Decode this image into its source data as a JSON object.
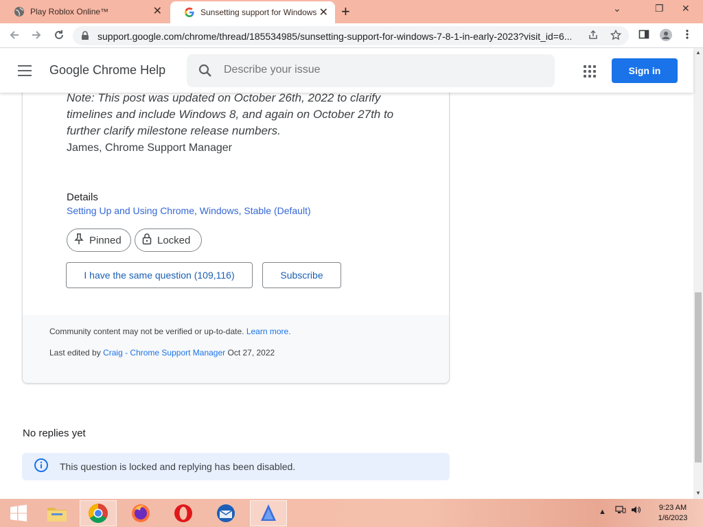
{
  "tabs": [
    {
      "title": "Play Roblox Online™",
      "close": "✕"
    },
    {
      "title": "Sunsetting support for Windows",
      "close": "✕"
    }
  ],
  "new_tab_label": "+",
  "window_controls": {
    "minimize": "⌄",
    "restore": "❐",
    "close": "✕"
  },
  "address_bar": {
    "url": "support.google.com/chrome/thread/185534985/sunsetting-support-for-windows-7-8-1-in-early-2023?visit_id=6..."
  },
  "header": {
    "site_title": "Google Chrome Help",
    "search_placeholder": "Describe your issue",
    "signin_label": "Sign in"
  },
  "post": {
    "note": "Note: This post was updated on October 26th, 2022 to clarify timelines and include Windows 8, and again on October 27th to further clarify milestone release numbers.",
    "signature": "James, Chrome Support Manager",
    "details_label": "Details",
    "details_links": [
      "Setting Up and Using Chrome",
      "Windows",
      "Stable (Default)"
    ],
    "details_separator": ", ",
    "chips": {
      "pinned": "Pinned",
      "locked": "Locked"
    },
    "same_question_label": "I have the same question (109,116)",
    "subscribe_label": "Subscribe",
    "community_note": "Community content may not be verified or up-to-date.",
    "learn_more": "Learn more.",
    "last_edited_prefix": "Last edited by",
    "last_edited_author": "Craig - Chrome Support Manager",
    "last_edited_date": "Oct 27, 2022"
  },
  "replies": {
    "heading": "No replies yet",
    "locked_notice": "This question is locked and replying has been disabled."
  },
  "taskbar": {
    "apps": [
      "start-icon",
      "file-explorer-icon",
      "chrome-icon",
      "firefox-icon",
      "opera-icon",
      "thunderbird-icon",
      "app-icon"
    ],
    "tray": "▲",
    "time": "9:23 AM",
    "date": "1/6/2023"
  },
  "colors": {
    "accent": "#1a73e8",
    "titlebar": "#f6b7a4",
    "link": "#3367d6",
    "notice_bg": "#e8f0fe"
  }
}
